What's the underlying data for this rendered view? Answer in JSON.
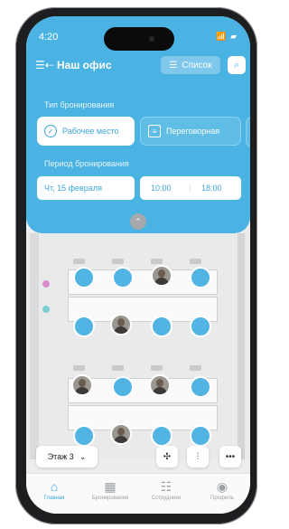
{
  "status": {
    "time": "4:20",
    "indicators": "📶 ▰"
  },
  "header": {
    "back_icon": "menu-back-icon",
    "title": "Наш офис",
    "list_label": "Список",
    "list_icon": "list-icon",
    "search_icon": "search-icon"
  },
  "booking": {
    "type_label": "Тип бронирования",
    "types": [
      {
        "label": "Рабочее место",
        "selected": true,
        "icon": "check-circle-icon"
      },
      {
        "label": "Переговорная",
        "selected": false,
        "icon": "meeting-room-icon"
      }
    ],
    "period_label": "Период бронирования",
    "date": "Чт, 15 февраля",
    "time_from": "10:00",
    "time_to": "18:00"
  },
  "map": {
    "floor_label": "Этаж 3",
    "collapse_icon": "chevron-up-icon",
    "locate_icon": "locate-icon",
    "filter_icon": "filter-icon",
    "more_icon": "more-icon"
  },
  "tabs": [
    {
      "label": "Главная",
      "icon": "home-icon",
      "glyph": "⌂",
      "active": true
    },
    {
      "label": "Бронирования",
      "icon": "calendar-icon",
      "glyph": "▦",
      "active": false
    },
    {
      "label": "Сотрудники",
      "icon": "people-icon",
      "glyph": "☷",
      "active": false
    },
    {
      "label": "Профиль",
      "icon": "profile-icon",
      "glyph": "◉",
      "active": false
    }
  ],
  "colors": {
    "accent": "#4bb3e3",
    "seat_free": "#52b4e2"
  }
}
